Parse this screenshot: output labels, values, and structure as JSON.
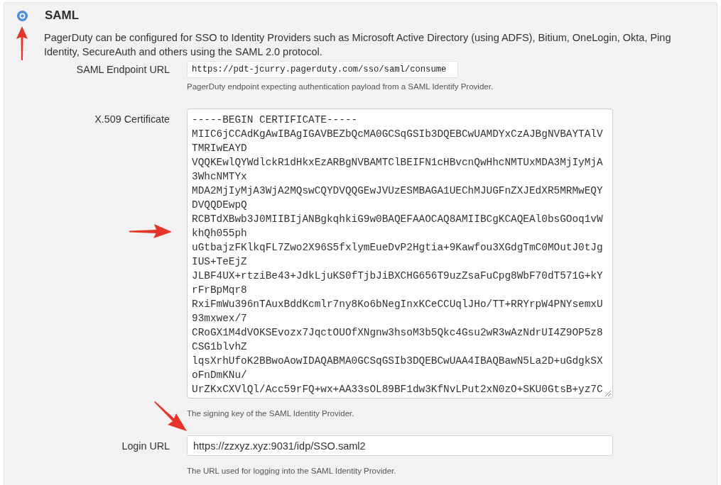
{
  "sso_option": {
    "title": "SAML",
    "selected": true,
    "description": "PagerDuty can be configured for SSO to Identity Providers such as Microsoft Active Directory (using ADFS), Bitium, OneLogin, Okta, Ping Identity, SecureAuth and others using the SAML 2.0 protocol."
  },
  "fields": [
    {
      "kind": "readonly",
      "label": "SAML Endpoint URL",
      "value": "https://pdt-jcurry.pagerduty.com/sso/saml/consume",
      "help": "PagerDuty endpoint expecting authentication payload from a SAML Identify Provider."
    },
    {
      "kind": "textarea",
      "label": "X.509 Certificate",
      "value_lines": [
        "-----BEGIN CERTIFICATE-----",
        "MIIC6jCCAdKgAwIBAgIGAVBEZbQcMA0GCSqGSIb3DQEBCwUAMDYxCzAJBgNVBAYTAlV",
        "TMRIwEAYD",
        "VQQKEwlQYWdlckR1dHkxEzARBgNVBAMTClBEIFN1cHBvcnQwHhcNMTUxMDA3MjIyMjA",
        "3WhcNMTYx",
        "MDA2MjIyMjA3WjA2MQswCQYDVQQGEwJVUzESMBAGA1UEChMJUGFnZXJEdXR5MRMwEQY",
        "DVQQDEwpQ",
        "RCBTdXBwb3J0MIIBIjANBgkqhkiG9w0BAQEFAAOCAQ8AMIIBCgKCAQEAl0bsGOoq1vW",
        "khQh055ph",
        "uGtbajzFKlkqFL7Zwo2X96S5fxlymEueDvP2Hgtia+9Kawfou3XGdgTmC0MOutJ0tJg",
        "IUS+TeEjZ",
        "JLBF4UX+rtziBe43+JdkLjuKS0fTjbJiBXCHG656T9uzZsaFuCpg8WbF70dT571G+kY",
        "rFrBpMqr8",
        "RxiFmWu396nTAuxBddKcmlr7ny8Ko6bNegInxKCeCCUqlJHo/TT+RRYrpW4PNYsemxU",
        "93mxwex/7",
        "CRoGX1M4dVOKSEvozx7JqctOUOfXNgnw3hsoM3b5Qkc4Gsu2wR3wAzNdrUI4Z9OP5z8",
        "CSG1blvhZ",
        "lqsXrhUfoK2BBwoAowIDAQABMA0GCSqGSIb3DQEBCwUAA4IBAQBawN5La2D+uGdgkSX",
        "oFnDmKNu/",
        "UrZKxCXVlQl/Acc59rFQ+wx+AA33sOL89BF1dw3KfNvLPut2xN0zO+SKU0GtsB+yz7C"
      ],
      "help": "The signing key of the SAML Identity Provider."
    },
    {
      "kind": "text",
      "label": "Login URL",
      "value": "https://zzxyz.xyz:9031/idp/SSO.saml2",
      "help": "The URL used for logging into the SAML Identity Provider."
    }
  ]
}
